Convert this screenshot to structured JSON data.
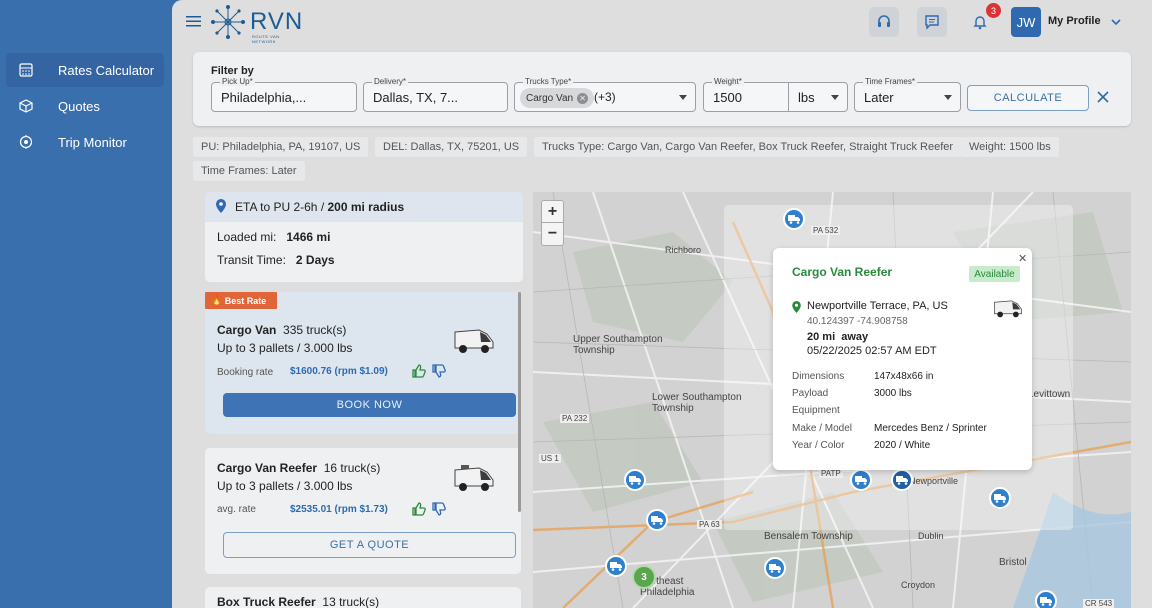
{
  "nav": {
    "items": [
      {
        "label": "Rates Calculator",
        "icon": "calculator-icon"
      },
      {
        "label": "Quotes",
        "icon": "box-icon"
      },
      {
        "label": "Trip Monitor",
        "icon": "location-target-icon"
      }
    ]
  },
  "header": {
    "brand": "RVN",
    "brand_sub": "ROUTE VAN NETWORK",
    "notifications_count": "3",
    "avatar_initials": "JW",
    "profile_label": "My Profile"
  },
  "filter": {
    "title": "Filter by",
    "pickup": {
      "label": "Pick Up",
      "value": "Philadelphia,..."
    },
    "delivery": {
      "label": "Delivery",
      "value": "Dallas, TX, 7..."
    },
    "trucks": {
      "label": "Trucks Type",
      "chip": "Cargo Van",
      "more": "(+3)"
    },
    "weight": {
      "label": "Weight",
      "value": "1500",
      "unit": "lbs"
    },
    "timeframes": {
      "label": "Time Frames",
      "value": "Later"
    },
    "calculate_label": "CALCULATE"
  },
  "tags": [
    "PU: Philadelphia, PA, 19107, US",
    "DEL: Dallas, TX, 75201, US",
    "Trucks Type: Cargo Van, Cargo Van Reefer, Box Truck Reefer, Straight Truck Reefer",
    "Weight: 1500 lbs",
    "Time Frames: Later"
  ],
  "summary": {
    "eta_prefix": "ETA to PU 2-6h / ",
    "eta_radius": "200 mi radius",
    "loaded_label": "Loaded mi:",
    "loaded_value": "1466 mi",
    "transit_label": "Transit Time:",
    "transit_value": "2 Days"
  },
  "offers": [
    {
      "best": "Best Rate",
      "name": "Cargo Van",
      "count": "335 truck(s)",
      "capacity": "Up to 3 pallets / 3.000 lbs",
      "rate_label": "Booking rate",
      "rate": "$1600.76 (rpm $1.09)",
      "action": "BOOK NOW"
    },
    {
      "name": "Cargo Van Reefer",
      "count": "16 truck(s)",
      "capacity": "Up to 3 pallets / 3.000 lbs",
      "rate_label": "avg. rate",
      "rate": "$2535.01 (rpm $1.73)",
      "action": "GET A QUOTE"
    },
    {
      "name": "Box Truck Reefer",
      "count": "13 truck(s)"
    }
  ],
  "map": {
    "labels": [
      "Richboro",
      "PA 532",
      "Upper Southampton Township",
      "Lower Southampton Township",
      "PA 232",
      "US 1",
      "PA 63",
      "Bensalem Township",
      "Northeast Philadelphia",
      "Levittown",
      "Bristol",
      "Croydon",
      "Dublin",
      "PATP",
      "CR 543",
      "Newportville"
    ],
    "cluster_count": "3"
  },
  "popup": {
    "name": "Cargo Van Reefer",
    "status": "Available",
    "location": "Newportville Terrace, PA, US",
    "coords": "40.124397 -74.908758",
    "distance": "20 mi  away",
    "datetime": "05/22/2025 02:57 AM EDT",
    "rows": [
      {
        "k": "Dimensions",
        "v": "147x48x66 in"
      },
      {
        "k": "Payload",
        "v": "3000 lbs"
      },
      {
        "k": "Equipment",
        "v": ""
      },
      {
        "k": "Make / Model",
        "v": "Mercedes Benz / Sprinter"
      },
      {
        "k": "Year / Color",
        "v": "2020 / White"
      }
    ]
  },
  "colors": {
    "sidebar": "#3a6fae",
    "accent": "#2f6ab0",
    "available": "#2a8a3c",
    "best_rate": "#e0663a"
  }
}
